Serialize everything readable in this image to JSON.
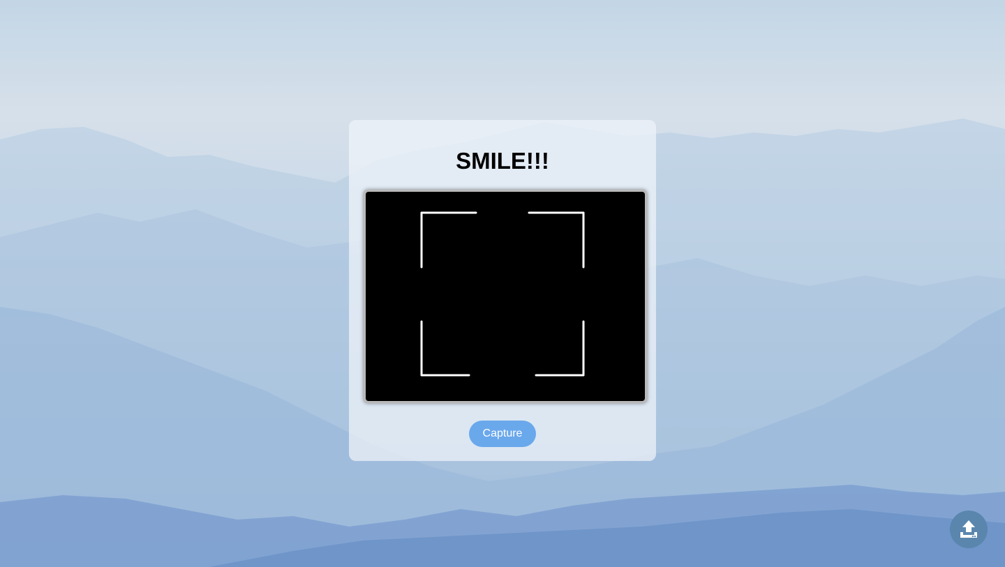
{
  "page": {
    "title": "SMILE!!!"
  },
  "camera": {
    "state": "no video feed",
    "frame_color": "#ffffff"
  },
  "actions": {
    "capture_label": "Capture",
    "upload_icon": "upload-icon"
  },
  "colors": {
    "accent": "#6aa8ec",
    "upload_button": "#5a86ae",
    "card_background": "#eef3f8"
  }
}
